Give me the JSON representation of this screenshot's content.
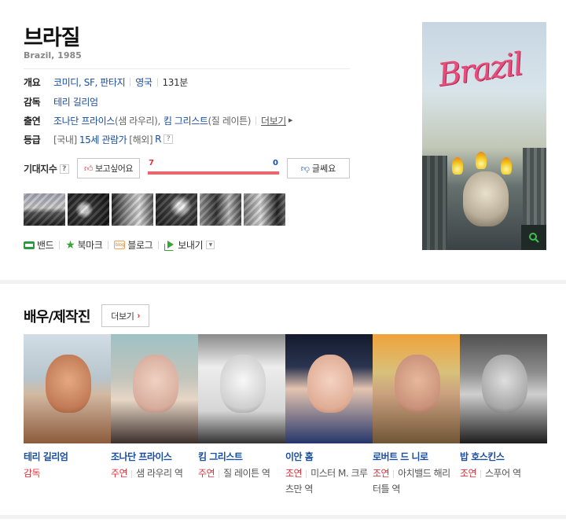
{
  "movie": {
    "title": "브라질",
    "subtitle": "Brazil, 1985"
  },
  "info": {
    "overview_label": "개요",
    "genres": "코미디, SF, 판타지",
    "country": "영국",
    "runtime": "131분",
    "director_label": "감독",
    "director": "테리 길리엄",
    "cast_label": "출연",
    "cast_1": "조나단 프라이스",
    "cast_1_role": "(샘 라우리),",
    "cast_2": "킴 그리스트",
    "cast_2_role": "(질 레이튼)",
    "cast_more": "더보기",
    "rating_label": "등급",
    "rating_domestic_prefix": "[국내]",
    "rating_domestic": "15세 관람가",
    "rating_overseas_prefix": "[해외]",
    "rating_overseas": "R",
    "help_symbol": "?"
  },
  "expectation": {
    "label": "기대지수",
    "want_label": "보고싶어요",
    "want_count": "7",
    "notsure_label": "글쎄요",
    "notsure_count": "0",
    "want_fraction": 1.0
  },
  "share": {
    "band": "밴드",
    "bookmark": "북마크",
    "blog": "블로그",
    "send": "보내기",
    "blog_icon_text": "blog"
  },
  "poster": {
    "title_text": "Brazil"
  },
  "cast_section": {
    "heading": "배우/제작진",
    "more_label": "더보기",
    "members": [
      {
        "name": "테리 길리엄",
        "type": "감독",
        "role": ""
      },
      {
        "name": "조나단 프라이스",
        "type": "주연",
        "role": "샘 라우리 역"
      },
      {
        "name": "킴 그리스트",
        "type": "주연",
        "role": "질 레이튼 역"
      },
      {
        "name": "이안 홈",
        "type": "조연",
        "role": "미스터 M. 크루츠만 역"
      },
      {
        "name": "로버트 드 니로",
        "type": "조연",
        "role": "아치밸드 해리 터틀 역"
      },
      {
        "name": "밥 호스킨스",
        "type": "조연",
        "role": "스푸어 역"
      }
    ]
  },
  "colors": {
    "link": "#1a4ea0",
    "accent_red": "#e0333c",
    "brand_green": "#37a635"
  }
}
